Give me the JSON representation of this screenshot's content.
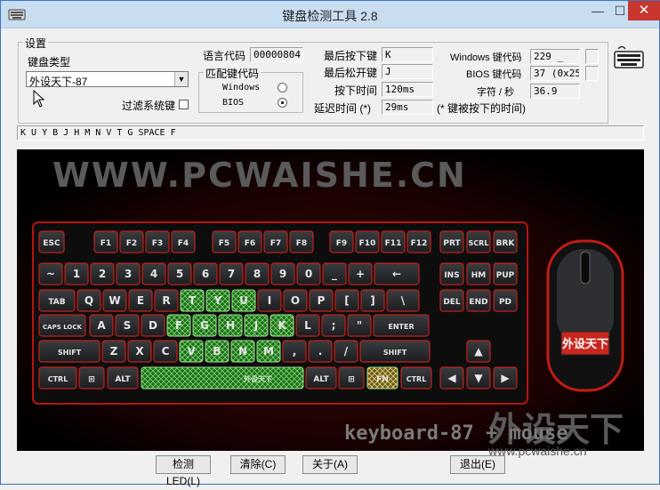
{
  "window": {
    "title": "键盘检测工具 2.8",
    "min_label": "—",
    "max_label": "☐",
    "close_label": "✕"
  },
  "settings": {
    "legend": "设置",
    "keyboard_type_label": "键盘类型",
    "keyboard_type_value": "外设天下-87",
    "filter_system_keys_label": "过滤系统键",
    "filter_checked": false,
    "match_code_legend": "匹配键代码",
    "match_windows_label": "Windows",
    "match_bios_label": "BIOS",
    "match_selected": "BIOS"
  },
  "info": {
    "lang_code_label": "语言代码",
    "lang_code_value": "00000804",
    "last_pressed_label": "最后按下键",
    "last_pressed_value": "K",
    "last_released_label": "最后松开键",
    "last_released_value": "J",
    "press_time_label": "按下时间",
    "press_time_value": "120ms",
    "delay_label": "延迟时间 (*)",
    "delay_value": "29ms",
    "delay_note": "(* 键被按下的时间)",
    "windows_code_label": "Windows 键代码",
    "windows_code_value": "229  _",
    "bios_code_label": "BIOS 键代码",
    "bios_code_value": "37 (0x25)",
    "cps_label": "字符 / 秒",
    "cps_value": "36.9"
  },
  "history": "K U Y B J H M N V T G SPACE F",
  "display": {
    "site_banner": "WWW.PCWAISHE.CN",
    "model_caption": "keyboard-87 + mouse",
    "brand_mark": "外设天下",
    "mouse_badge": "外设天下",
    "spacebar_mark": "外设天下",
    "rows": [
      [
        "ESC",
        "F1",
        "F2",
        "F3",
        "F4",
        "F5",
        "F6",
        "F7",
        "F8",
        "F9",
        "F10",
        "F11",
        "F12",
        "PRT",
        "SCRL",
        "BRK"
      ],
      [
        "~",
        "1",
        "2",
        "3",
        "4",
        "5",
        "6",
        "7",
        "8",
        "9",
        "0",
        "_",
        "+",
        "←",
        "INS",
        "HM",
        "PUP"
      ],
      [
        "TAB",
        "Q",
        "W",
        "E",
        "R",
        "T",
        "Y",
        "U",
        "I",
        "O",
        "P",
        "[",
        "]",
        "\\",
        "DEL",
        "END",
        "PD"
      ],
      [
        "CAPS LOCK",
        "A",
        "S",
        "D",
        "F",
        "G",
        "H",
        "J",
        "K",
        "L",
        ";",
        "\"",
        "ENTER"
      ],
      [
        "SHIFT",
        "Z",
        "X",
        "C",
        "V",
        "B",
        "N",
        "M",
        ",",
        ".",
        "/",
        "SHIFT",
        "▲"
      ],
      [
        "CTRL",
        "WIN",
        "ALT",
        "SPACE",
        "ALT",
        "WIN",
        "FN",
        "CTRL",
        "◀",
        "▼",
        "▶"
      ]
    ],
    "pressed_keys": [
      "T",
      "Y",
      "U",
      "F",
      "G",
      "H",
      "J",
      "K",
      "V",
      "B",
      "N",
      "M",
      "SPACE",
      "FN"
    ]
  },
  "buttons": {
    "led": "检测LED(L)",
    "clear": "清除(C)",
    "about": "关于(A)",
    "exit": "退出(E)"
  },
  "watermark_url": "www.pcwaishe.cn",
  "colors": {
    "accent_red": "#e0201a",
    "pressed_green": "#3fb53a",
    "key_face": "#2a2c2f"
  }
}
